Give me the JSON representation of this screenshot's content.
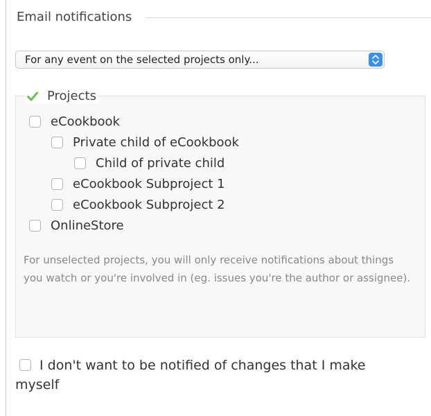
{
  "section": {
    "title": "Email notifications"
  },
  "notification_select": {
    "selected": "For any event on the selected projects only...",
    "accent_color": "#3b8ef5"
  },
  "projects": {
    "legend": "Projects",
    "legend_icon": "checkmark-icon",
    "legend_icon_color": "#6cbf4a",
    "items": [
      {
        "label": "eCookbook",
        "checked": false
      },
      {
        "label": "Private child of eCookbook",
        "checked": false
      },
      {
        "label": "Child of private child",
        "checked": false
      },
      {
        "label": "eCookbook Subproject 1",
        "checked": false
      },
      {
        "label": "eCookbook Subproject 2",
        "checked": false
      },
      {
        "label": "OnlineStore",
        "checked": false
      }
    ],
    "help": "For unselected projects, you will only receive notifications about things you watch or you're involved in (eg. issues you're the author or assignee)."
  },
  "no_self_notified": {
    "label_line1": "I don't want to be notified of changes that I make",
    "label_line2": "myself",
    "checked": false
  }
}
